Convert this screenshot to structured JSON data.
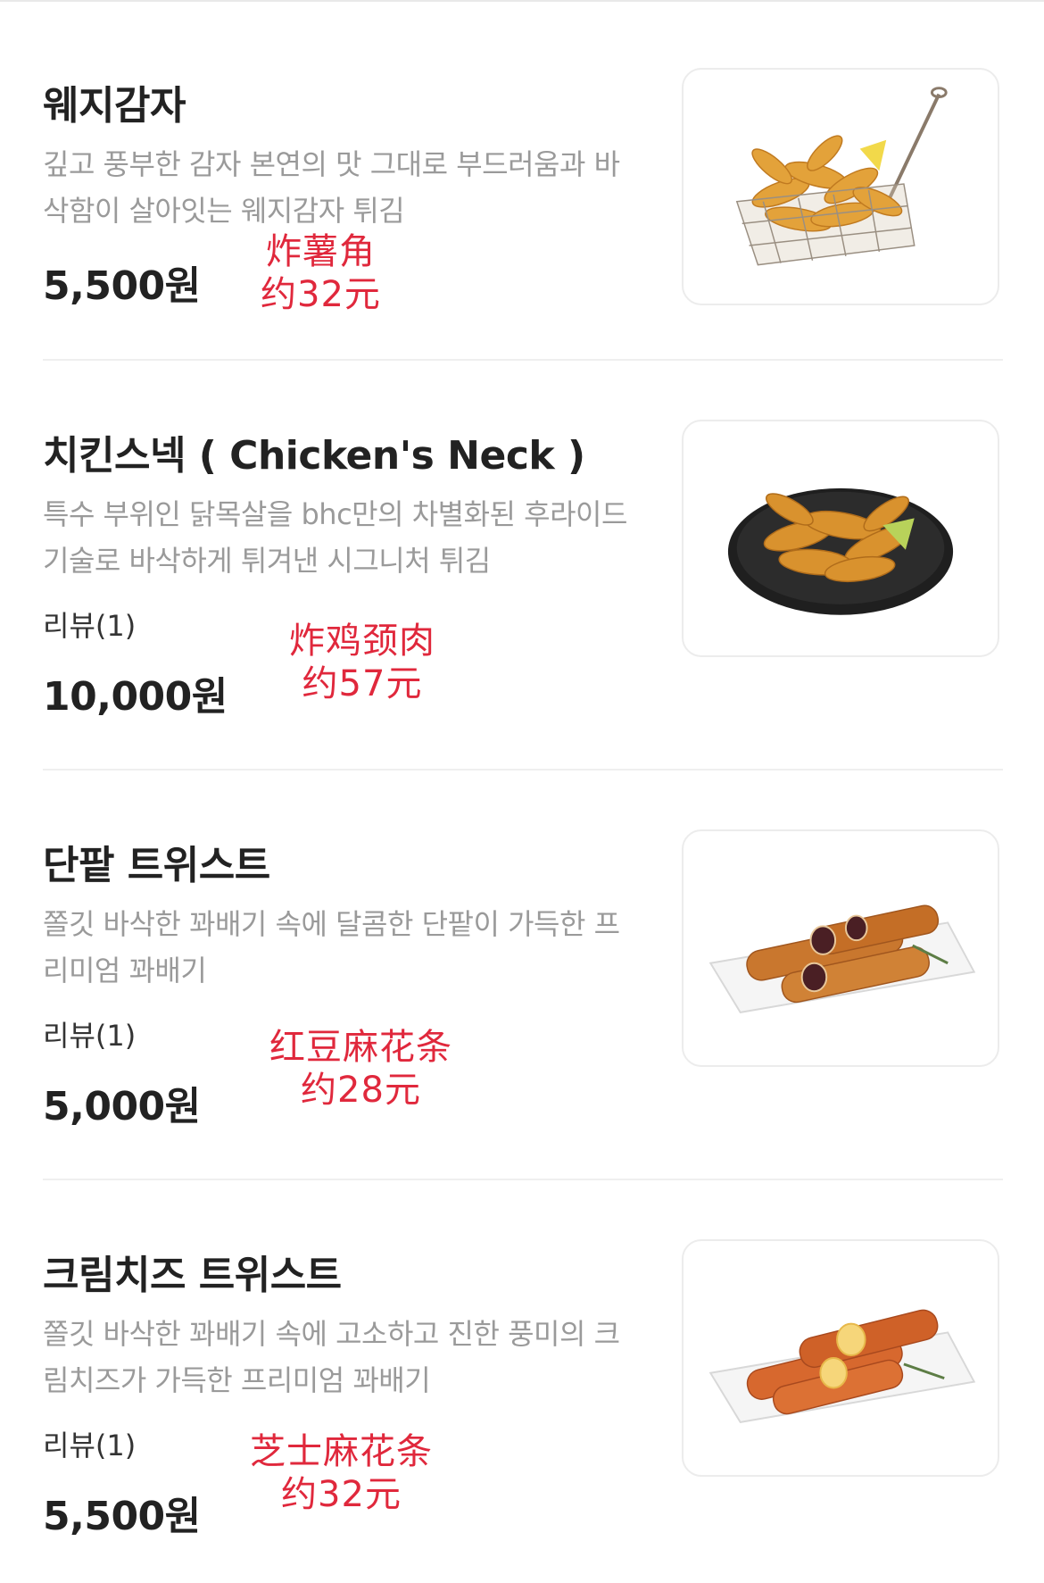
{
  "menu": {
    "items": [
      {
        "name": "웨지감자",
        "description": "깊고 풍부한 감자 본연의 맛 그대로 부드러움과 바삭함이 살아잇는 웨지감자 튀김",
        "review": "",
        "price": "5,500원",
        "annotation": {
          "name": "炸薯角",
          "price": "约32元"
        },
        "image_icon": "potato-wedges-image"
      },
      {
        "name": "치킨스넥 ( Chicken's Neck )",
        "description": "특수 부위인 닭목살을 bhc만의 차별화된 후라이드 기술로 바삭하게 튀겨낸 시그니처 튀김",
        "review": "리뷰(1)",
        "price": "10,000원",
        "annotation": {
          "name": "炸鸡颈肉",
          "price": "约57元"
        },
        "image_icon": "fried-chicken-neck-image"
      },
      {
        "name": "단팥 트위스트",
        "description": "쫄깃 바삭한 꽈배기 속에 달콤한 단팥이 가득한 프리미엄 꽈배기",
        "review": "리뷰(1)",
        "price": "5,000원",
        "annotation": {
          "name": "红豆麻花条",
          "price": "约28元"
        },
        "image_icon": "red-bean-twist-image"
      },
      {
        "name": "크림치즈 트위스트",
        "description": "쫄깃 바삭한 꽈배기 속에 고소하고 진한 풍미의 크림치즈가 가득한 프리미엄 꽈배기",
        "review": "리뷰(1)",
        "price": "5,500원",
        "annotation": {
          "name": "芝士麻花条",
          "price": "约32元"
        },
        "image_icon": "cream-cheese-twist-image"
      }
    ]
  },
  "colors": {
    "annotation": "#e0283c",
    "description": "#9a9a9a",
    "title": "#222222",
    "divider": "#efefef"
  }
}
